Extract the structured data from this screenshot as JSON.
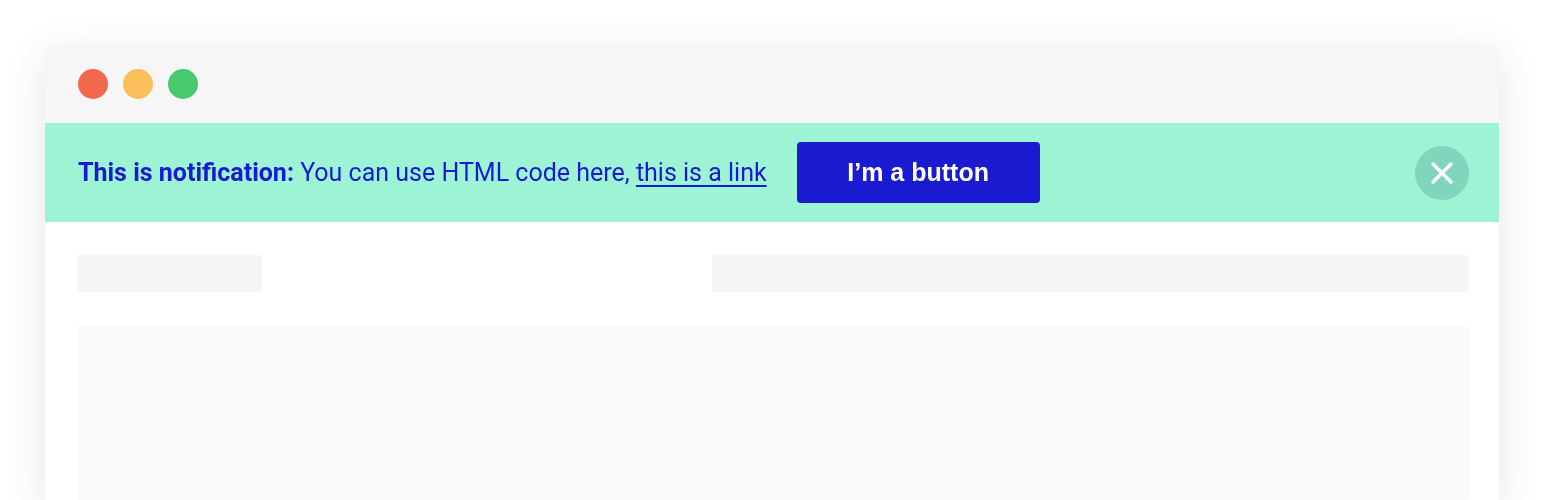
{
  "notification": {
    "message": "**This is notification:** You can use HTML code here, ",
    "link": "this is a link",
    "button": "I’m a button"
  }
}
